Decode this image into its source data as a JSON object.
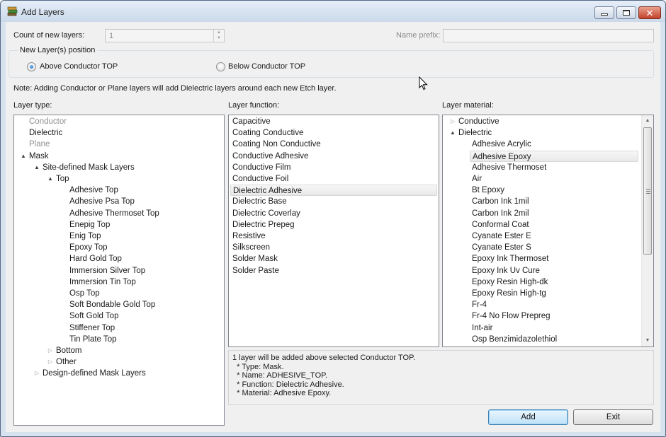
{
  "window": {
    "title": "Add Layers"
  },
  "form": {
    "count_label": "Count of new layers:",
    "count_value": "1",
    "prefix_label": "Name prefix:",
    "prefix_value": "",
    "position_group_label": "New Layer(s) position",
    "above_label": "Above Conductor TOP",
    "below_label": "Below Conductor TOP",
    "selected_position": "above",
    "note": "Note: Adding Conductor or Plane layers will add Dielectric layers around each new Etch layer."
  },
  "layer_type": {
    "label": "Layer type:",
    "items": [
      {
        "text": "Conductor",
        "level": 0,
        "disabled": true
      },
      {
        "text": "Dielectric",
        "level": 0
      },
      {
        "text": "Plane",
        "level": 0,
        "disabled": true
      },
      {
        "text": "Mask",
        "level": 0,
        "expander": "expanded"
      },
      {
        "text": "Site-defined Mask Layers",
        "level": 1,
        "expander": "expanded"
      },
      {
        "text": "Top",
        "level": 2,
        "expander": "expanded"
      },
      {
        "text": "Adhesive Top",
        "level": 3
      },
      {
        "text": "Adhesive Psa Top",
        "level": 3
      },
      {
        "text": "Adhesive Thermoset Top",
        "level": 3
      },
      {
        "text": "Enepig Top",
        "level": 3
      },
      {
        "text": "Enig Top",
        "level": 3
      },
      {
        "text": "Epoxy Top",
        "level": 3
      },
      {
        "text": "Hard Gold Top",
        "level": 3
      },
      {
        "text": "Immersion Silver Top",
        "level": 3
      },
      {
        "text": "Immersion Tin Top",
        "level": 3
      },
      {
        "text": "Osp Top",
        "level": 3
      },
      {
        "text": "Soft Bondable Gold Top",
        "level": 3
      },
      {
        "text": "Soft Gold Top",
        "level": 3
      },
      {
        "text": "Stiffener Top",
        "level": 3
      },
      {
        "text": "Tin Plate Top",
        "level": 3
      },
      {
        "text": "Bottom",
        "level": 2,
        "expander": "collapsed"
      },
      {
        "text": "Other",
        "level": 2,
        "expander": "collapsed"
      },
      {
        "text": "Design-defined Mask Layers",
        "level": 1,
        "expander": "collapsed"
      }
    ]
  },
  "layer_function": {
    "label": "Layer function:",
    "items": [
      "Capacitive",
      "Coating Conductive",
      "Coating Non Conductive",
      "Conductive Adhesive",
      "Conductive Film",
      "Conductive Foil",
      "Dielectric Adhesive",
      "Dielectric Base",
      "Dielectric Coverlay",
      "Dielectric Prepeg",
      "Resistive",
      "Silkscreen",
      "Solder Mask",
      "Solder Paste"
    ],
    "selected": "Dielectric Adhesive"
  },
  "layer_material": {
    "label": "Layer material:",
    "items": [
      {
        "text": "Conductive",
        "level": 0,
        "expander": "collapsed"
      },
      {
        "text": "Dielectric",
        "level": 0,
        "expander": "expanded"
      },
      {
        "text": "Adhesive Acrylic",
        "level": 1
      },
      {
        "text": "Adhesive Epoxy",
        "level": 1,
        "selected": true
      },
      {
        "text": "Adhesive Thermoset",
        "level": 1
      },
      {
        "text": "Air",
        "level": 1
      },
      {
        "text": "Bt Epoxy",
        "level": 1
      },
      {
        "text": "Carbon Ink 1mil",
        "level": 1
      },
      {
        "text": "Carbon Ink 2mil",
        "level": 1
      },
      {
        "text": "Conformal Coat",
        "level": 1
      },
      {
        "text": "Cyanate Ester E",
        "level": 1
      },
      {
        "text": "Cyanate Ester S",
        "level": 1
      },
      {
        "text": "Epoxy Ink Thermoset",
        "level": 1
      },
      {
        "text": "Epoxy Ink Uv Cure",
        "level": 1
      },
      {
        "text": "Epoxy Resin High-dk",
        "level": 1
      },
      {
        "text": "Epoxy Resin High-tg",
        "level": 1
      },
      {
        "text": "Fr-4",
        "level": 1
      },
      {
        "text": "Fr-4 No Flow Prepreg",
        "level": 1
      },
      {
        "text": "Int-air",
        "level": 1
      },
      {
        "text": "Osp Benzimidazolethiol",
        "level": 1
      }
    ]
  },
  "summary": [
    "1 layer will be added above selected Conductor TOP.",
    "  * Type: Mask.",
    "  * Name: ADHESIVE_TOP.",
    "  * Function: Dielectric Adhesive.",
    "  * Material: Adhesive Epoxy."
  ],
  "buttons": {
    "add": "Add",
    "exit": "Exit"
  },
  "icons": {
    "app": "layers-icon",
    "expanded": "▲",
    "collapsed": "▷"
  }
}
